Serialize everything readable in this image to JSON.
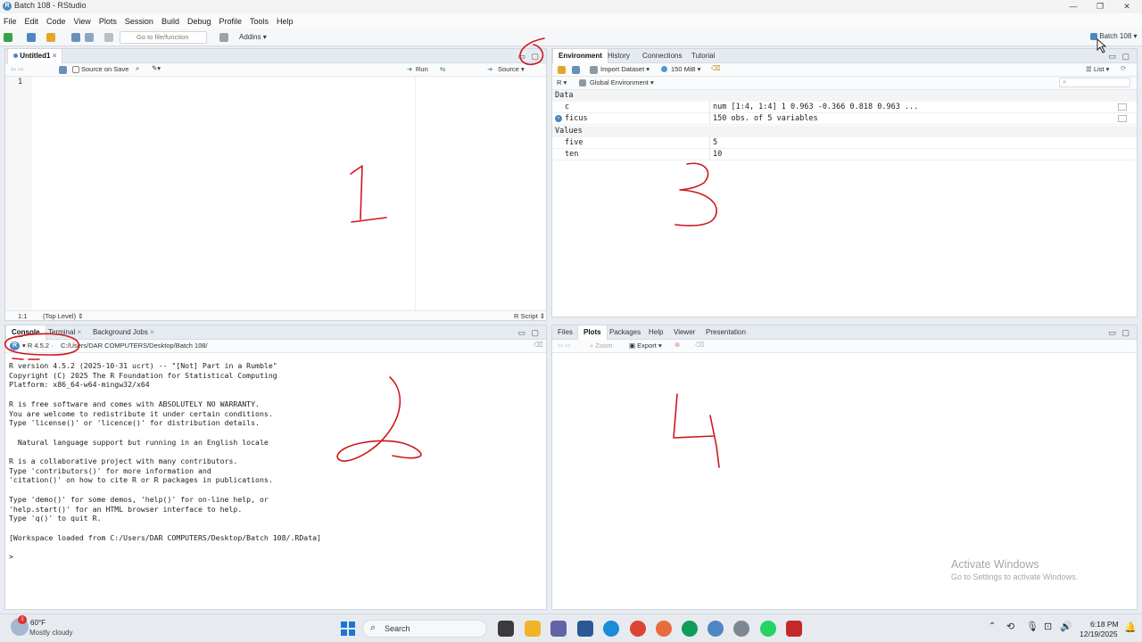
{
  "window": {
    "title": "Batch 108 - RStudio",
    "logo": "R"
  },
  "menu": [
    "File",
    "Edit",
    "Code",
    "View",
    "Plots",
    "Session",
    "Build",
    "Debug",
    "Profile",
    "Tools",
    "Help"
  ],
  "toolbar": {
    "goto_placeholder": "Go to file/function",
    "addins": "Addins",
    "project": "Batch 108"
  },
  "editor": {
    "tab": "Untitled1",
    "source_on_save": "Source on Save",
    "run": "Run",
    "source": "Source",
    "line_number": "1",
    "position": "1:1",
    "scope": "(Top Level)",
    "filetype": "R Script"
  },
  "environment": {
    "tabs": [
      "Environment",
      "History",
      "Connections",
      "Tutorial"
    ],
    "import_dataset": "Import Dataset",
    "memory": "150 MiB",
    "view_mode": "List",
    "language": "R",
    "scope": "Global Environment",
    "sections": {
      "data_label": "Data",
      "values_label": "Values",
      "data": [
        {
          "name": "c",
          "value": "num [1:4, 1:4] 1 0.963 -0.366 0.818 0.963 ..."
        },
        {
          "name": "ficus",
          "value": "150 obs. of 5 variables"
        }
      ],
      "values": [
        {
          "name": "five",
          "value": "5"
        },
        {
          "name": "ten",
          "value": "10"
        }
      ]
    }
  },
  "console": {
    "tabs": [
      "Console",
      "Terminal",
      "Background Jobs"
    ],
    "r_version": "R 4.5.2",
    "path": "C:/Users/DAR COMPUTERS/Desktop/Batch 108/",
    "lines": [
      "R version 4.5.2 (2025-10-31 ucrt) -- \"[Not] Part in a Rumble\"",
      "Copyright (C) 2025 The R Foundation for Statistical Computing",
      "Platform: x86_64-w64-mingw32/x64",
      "",
      "R is free software and comes with ABSOLUTELY NO WARRANTY.",
      "You are welcome to redistribute it under certain conditions.",
      "Type 'license()' or 'licence()' for distribution details.",
      "",
      "  Natural language support but running in an English locale",
      "",
      "R is a collaborative project with many contributors.",
      "Type 'contributors()' for more information and",
      "'citation()' on how to cite R or R packages in publications.",
      "",
      "Type 'demo()' for some demos, 'help()' for on-line help, or",
      "'help.start()' for an HTML browser interface to help.",
      "Type 'q()' to quit R.",
      "",
      "[Workspace loaded from C:/Users/DAR COMPUTERS/Desktop/Batch 108/.RData]",
      "",
      "> "
    ]
  },
  "files": {
    "tabs": [
      "Files",
      "Plots",
      "Packages",
      "Help",
      "Viewer",
      "Presentation"
    ],
    "zoom": "Zoom",
    "export": "Export"
  },
  "watermark": {
    "line1": "Activate Windows",
    "line2": "Go to Settings to activate Windows."
  },
  "taskbar": {
    "weather_temp": "60°F",
    "weather_desc": "Mostly cloudy",
    "search": "Search",
    "time": "6:18 PM",
    "date": "12/19/2025",
    "weather_badge": "1"
  },
  "annotations": [
    "1",
    "2",
    "3",
    "4"
  ],
  "colors": {
    "annotation": "#d0161b",
    "accent": "#4d86c3",
    "run_green": "#2a9d3a"
  }
}
